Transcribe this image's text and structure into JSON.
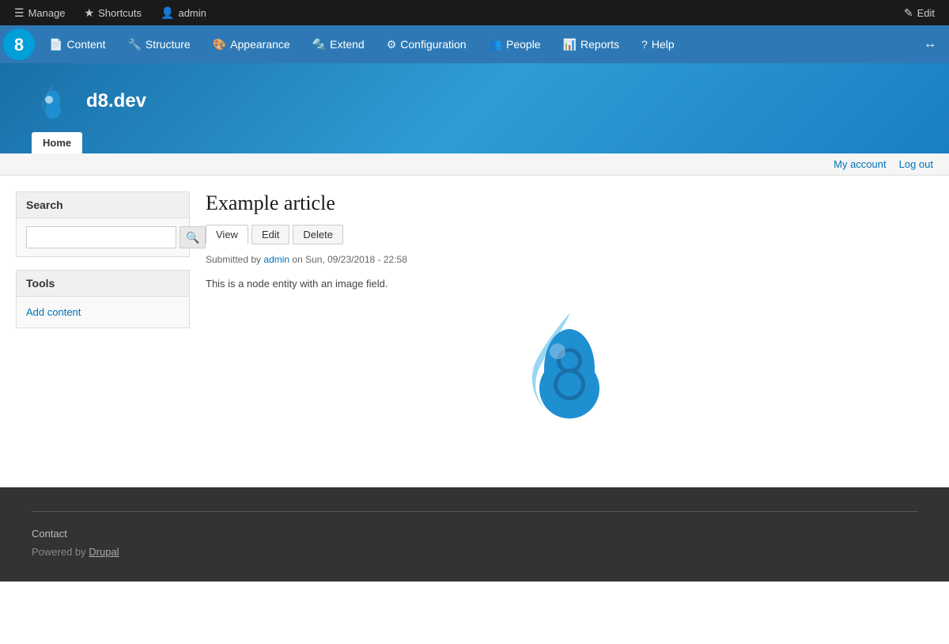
{
  "toolbar": {
    "manage_label": "Manage",
    "shortcuts_label": "Shortcuts",
    "user_label": "admin",
    "edit_label": "Edit",
    "manage_icon": "☰",
    "shortcuts_icon": "★",
    "user_icon": "👤",
    "edit_icon": "✎"
  },
  "nav": {
    "items": [
      {
        "id": "content",
        "label": "Content",
        "icon": "📄"
      },
      {
        "id": "structure",
        "label": "Structure",
        "icon": "🔧"
      },
      {
        "id": "appearance",
        "label": "Appearance",
        "icon": "🎨"
      },
      {
        "id": "extend",
        "label": "Extend",
        "icon": "🔩"
      },
      {
        "id": "configuration",
        "label": "Configuration",
        "icon": "⚙"
      },
      {
        "id": "people",
        "label": "People",
        "icon": "👥"
      },
      {
        "id": "reports",
        "label": "Reports",
        "icon": "📊"
      },
      {
        "id": "help",
        "label": "Help",
        "icon": "?"
      }
    ],
    "expand_icon": "↔"
  },
  "site": {
    "name": "d8.dev",
    "primary_nav": [
      {
        "id": "home",
        "label": "Home",
        "active": true
      }
    ]
  },
  "user_links": {
    "my_account": "My account",
    "log_out": "Log out"
  },
  "sidebar": {
    "search_block": {
      "title": "Search",
      "input_placeholder": "",
      "search_button_icon": "🔍"
    },
    "tools_block": {
      "title": "Tools",
      "links": [
        {
          "label": "Add content",
          "href": "#"
        }
      ]
    }
  },
  "article": {
    "title": "Example article",
    "tabs": [
      {
        "label": "View",
        "active": true
      },
      {
        "label": "Edit",
        "active": false
      },
      {
        "label": "Delete",
        "active": false
      }
    ],
    "submitted_by": "Submitted by",
    "author": "admin",
    "date": "on Sun, 09/23/2018 - 22:58",
    "body": "This is a node entity with an image field."
  },
  "footer": {
    "contact_link": "Contact",
    "powered_by": "Powered by ",
    "drupal_link": "Drupal"
  },
  "colors": {
    "nav_bg": "#2e79b5",
    "toolbar_bg": "#1a1a1a",
    "drupal_blue": "#1e8fd1",
    "link_color": "#0071b8"
  }
}
